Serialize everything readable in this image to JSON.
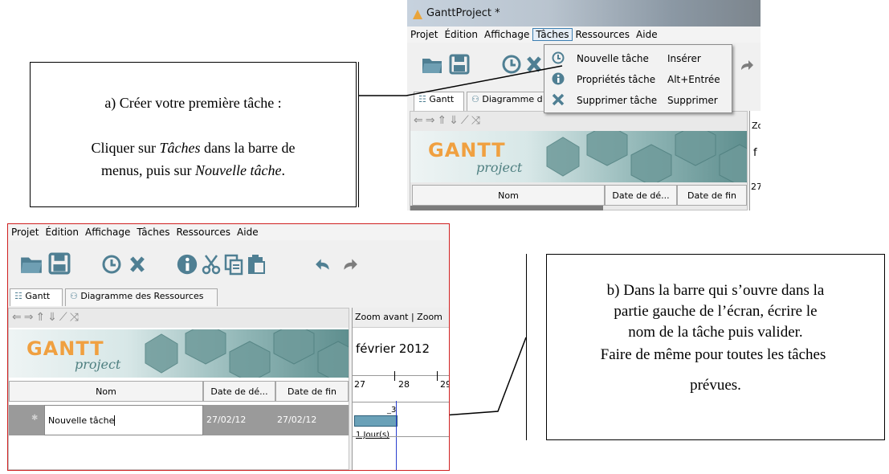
{
  "notes": {
    "a": {
      "line1": "a) Créer  votre première tâche :",
      "line2_pre": "Cliquer sur ",
      "line2_em": "Tâches",
      "line2_post": " dans  la barre de",
      "line3_pre": "menus, puis sur ",
      "line3_em": "Nouvelle tâche",
      "line3_post": "."
    },
    "b": {
      "line1": "b) Dans la barre qui s’ouvre  dans la",
      "line2": "partie gauche de l’écran, écrire le",
      "line3": "nom de la tâche puis valider.",
      "line4": "Faire  de  même pour toutes les tâches",
      "line5": "prévues."
    }
  },
  "top_window": {
    "title": "GanttProject *",
    "menu": [
      "Projet",
      "Édition",
      "Affichage",
      "Tâches",
      "Ressources",
      "Aide"
    ],
    "dropdown": [
      {
        "label": "Nouvelle tâche",
        "shortcut": "Insérer",
        "icon": "clock-icon"
      },
      {
        "label": "Propriétés tâche",
        "shortcut": "Alt+Entrée",
        "icon": "info-icon"
      },
      {
        "label": "Supprimer tâche",
        "shortcut": "Supprimer",
        "icon": "delete-x-icon"
      }
    ],
    "tabs": [
      "Gantt",
      "Diagramme d"
    ],
    "right_clip": {
      "zoom": "Zo",
      "month": "f",
      "day": "27"
    },
    "columns": [
      "Nom",
      "Date de dé...",
      "Date de fin"
    ]
  },
  "bottom_window": {
    "menu": [
      "Projet",
      "Édition",
      "Affichage",
      "Tâches",
      "Ressources",
      "Aide"
    ],
    "tabs": [
      "Gantt",
      "Diagramme des Ressources"
    ],
    "columns": [
      "Nom",
      "Date de dé...",
      "Date de fin"
    ],
    "task_row": {
      "name": "Nouvelle tâche",
      "start": "27/02/12",
      "end": "27/02/12"
    },
    "chart": {
      "zoom": "Zoom avant  |  Zoom",
      "month": "février 2012",
      "days": [
        "27",
        "28",
        "29"
      ],
      "bar_label": "1 Jour(s)",
      "bar_top_label": "_3"
    }
  },
  "logo": {
    "main": "GANTT",
    "sub": "project"
  },
  "colors": {
    "menu_highlight": "#3c7fb1",
    "window_border_red": "#d02020",
    "gantt_bar": "#6aa1b8",
    "today_line": "#2a3fcf",
    "logo_orange": "#f0a040"
  }
}
